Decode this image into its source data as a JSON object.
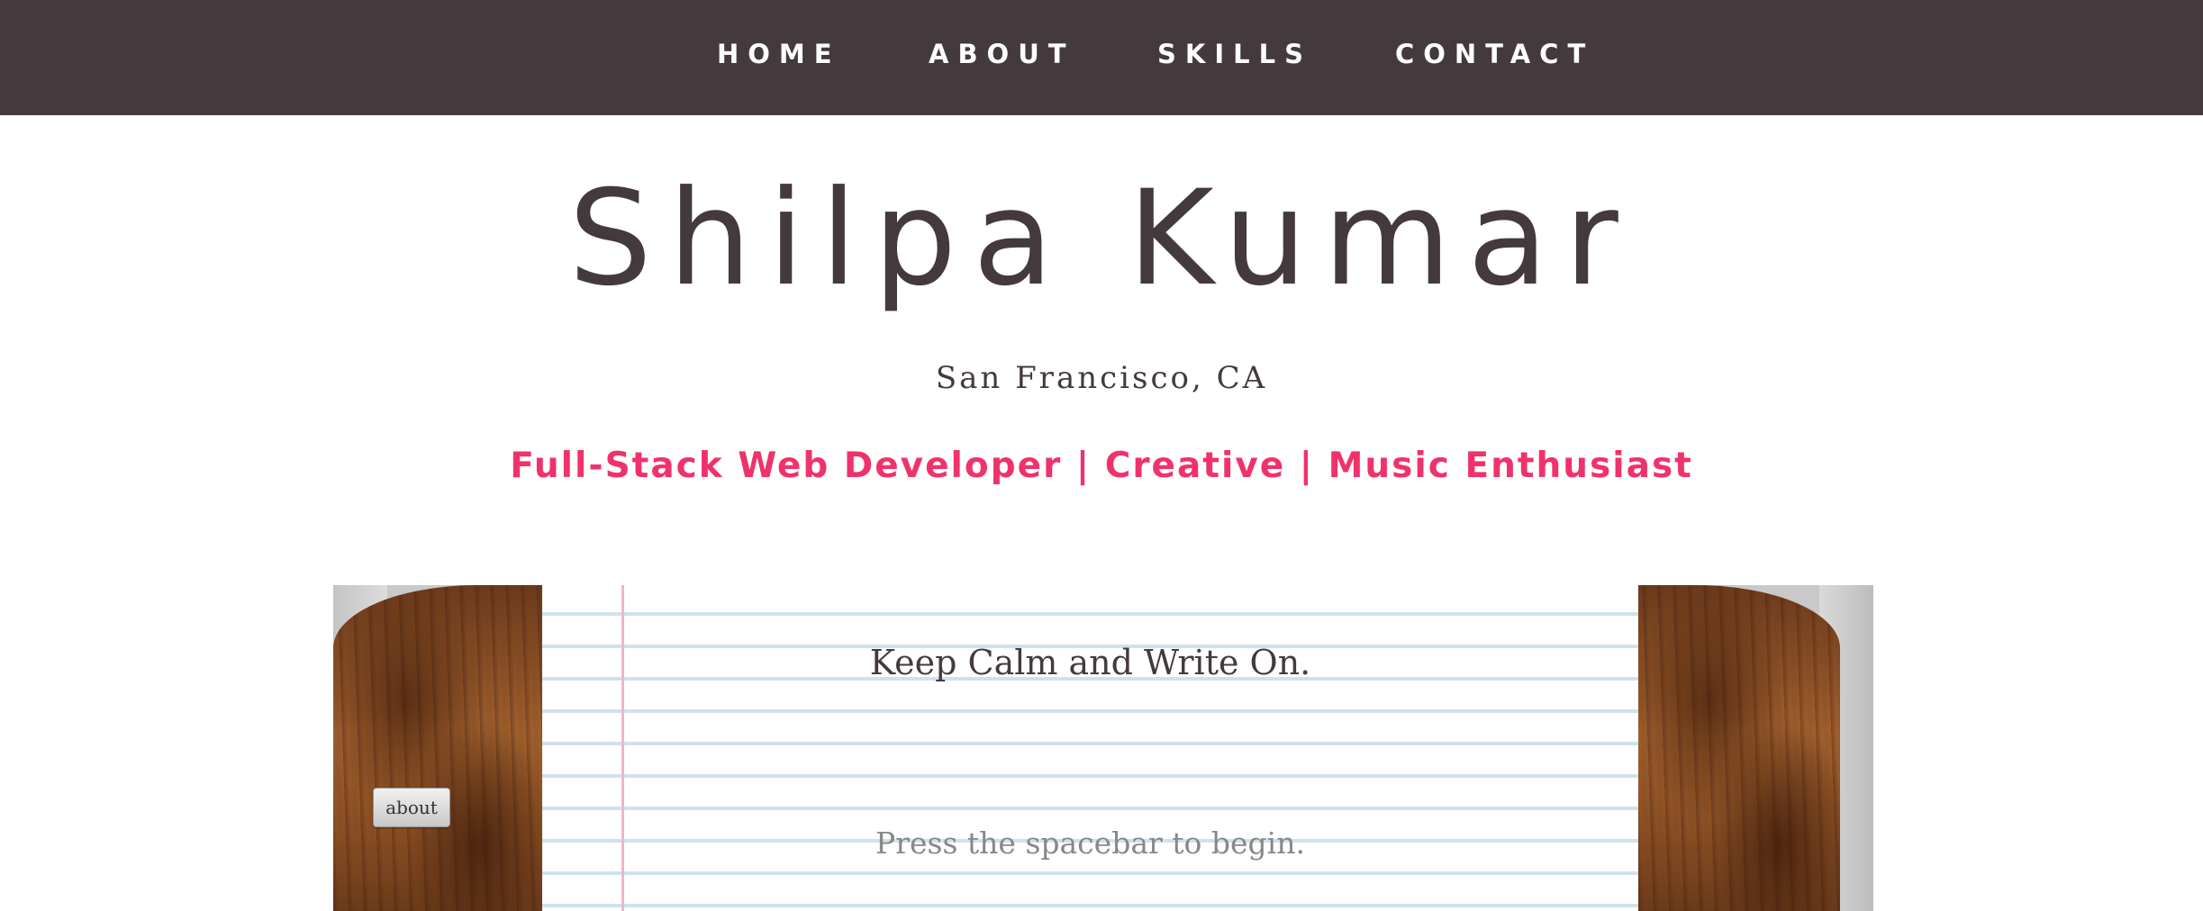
{
  "nav": {
    "items": [
      {
        "label": "HOME"
      },
      {
        "label": "ABOUT"
      },
      {
        "label": "SKILLS"
      },
      {
        "label": "CONTACT"
      }
    ]
  },
  "hero": {
    "name": "Shilpa Kumar",
    "location": "San Francisco, CA",
    "tagline": "Full-Stack Web Developer | Creative | Music Enthusiast"
  },
  "writer": {
    "heading": "Keep Calm and Write On.",
    "prompt": "Press the spacebar to begin.",
    "about_button": "about"
  },
  "colors": {
    "nav_background": "#443a3d",
    "text_dark": "#443a3d",
    "accent_pink": "#f0326b",
    "paper_rule": "#cfe2ec",
    "paper_margin": "#f4b4c8"
  }
}
